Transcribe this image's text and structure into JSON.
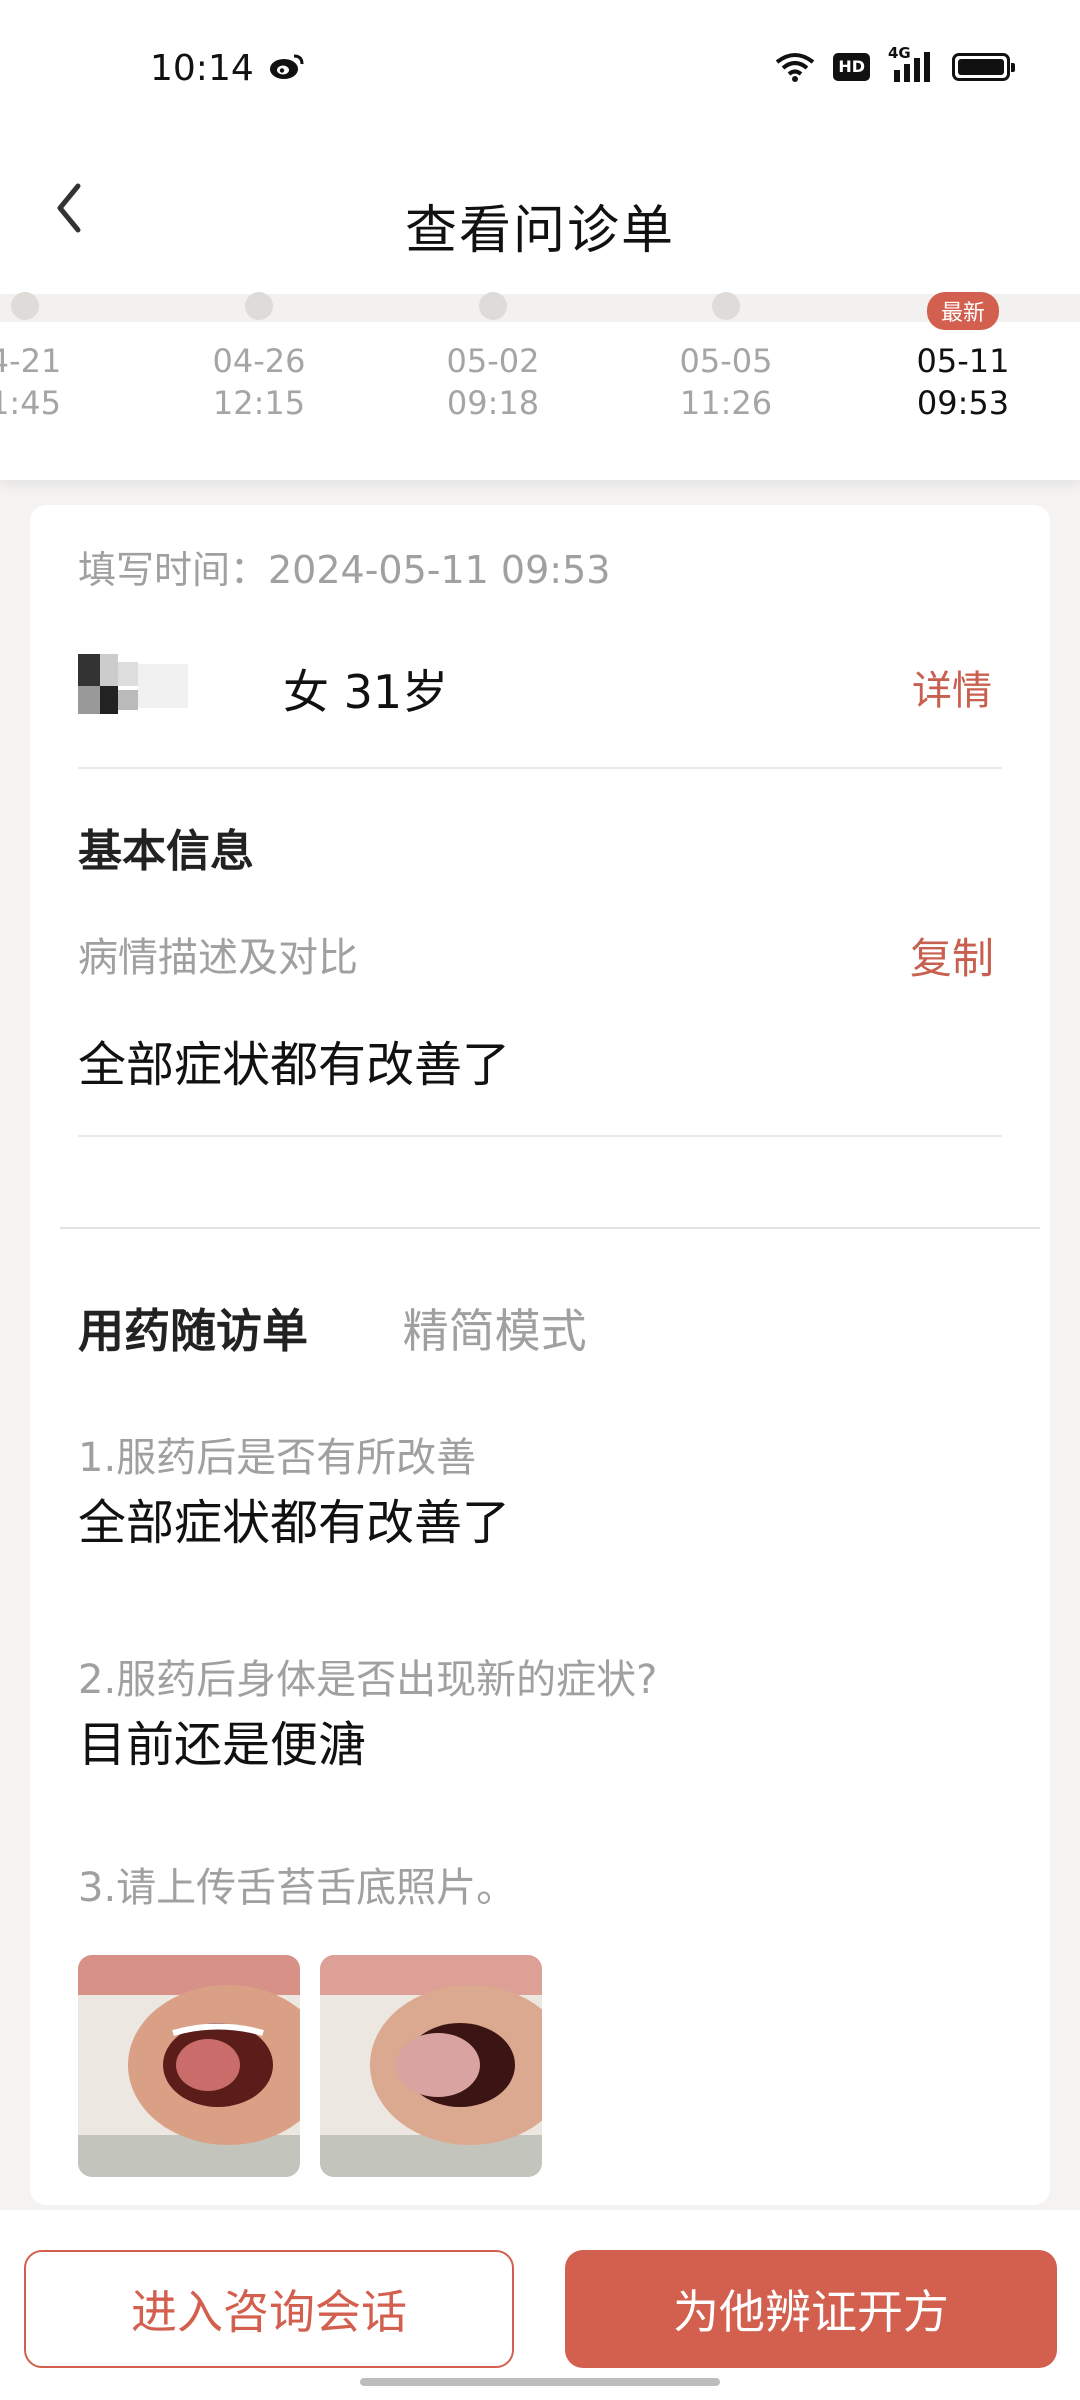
{
  "status_bar": {
    "time": "10:14",
    "hd": "HD",
    "network": "4G",
    "icons": [
      "weibo-icon",
      "wifi-icon",
      "signal-icon",
      "battery-icon"
    ]
  },
  "header": {
    "title": "查看问诊单",
    "back_icon": "back-arrow-icon"
  },
  "timeline": {
    "badge": "最新",
    "items": [
      {
        "date": "4-21",
        "time": "1:45"
      },
      {
        "date": "04-26",
        "time": "12:15"
      },
      {
        "date": "05-02",
        "time": "09:18"
      },
      {
        "date": "05-05",
        "time": "11:26"
      },
      {
        "date": "05-11",
        "time": "09:53"
      }
    ]
  },
  "card": {
    "fill_time": "填写时间：2024-05-11 09:53",
    "patient": {
      "info": "女 31岁",
      "detail": "详情"
    },
    "basic": {
      "title": "基本信息",
      "desc_label": "病情描述及对比",
      "copy": "复制",
      "desc": "全部症状都有改善了"
    },
    "followup": {
      "tab_active": "用药随访单",
      "tab_other": "精简模式",
      "questions": [
        {
          "q": "1.服药后是否有所改善",
          "a": "全部症状都有改善了"
        },
        {
          "q": "2.服药后身体是否出现新的症状?",
          "a": "目前还是便溏"
        },
        {
          "q": "3.请上传舌苔舌底照片。",
          "a": ""
        }
      ]
    }
  },
  "buttons": {
    "consult": "进入咨询会话",
    "prescribe": "为他辨证开方"
  },
  "colors": {
    "accent": "#d35f4e",
    "muted": "#a0a0a0",
    "background": "#f4f3f2"
  }
}
